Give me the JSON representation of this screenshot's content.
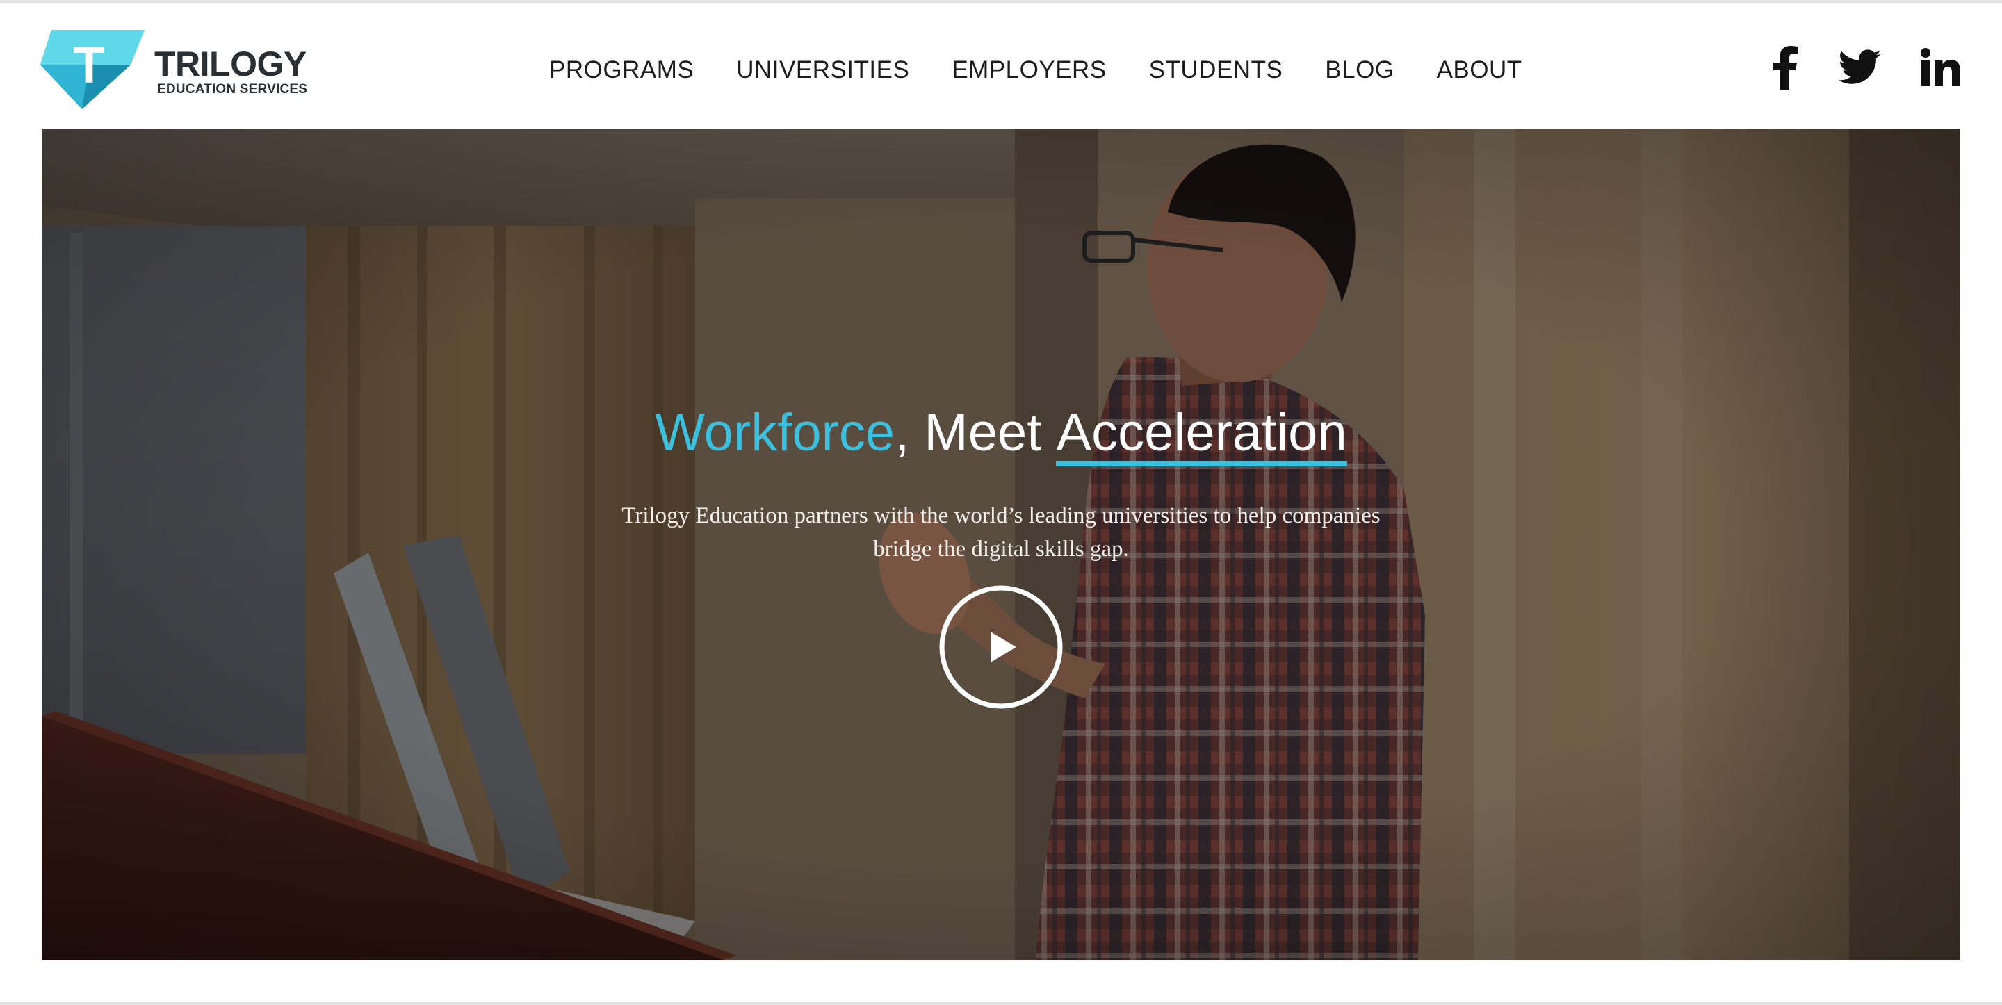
{
  "logo": {
    "wordmark": "TRILOGY",
    "subtitle": "EDUCATION SERVICES",
    "mark_letter": "T",
    "colors": {
      "light": "#5fd8ea",
      "mid": "#2fb5d3",
      "dark": "#1a8fae"
    }
  },
  "nav": {
    "items": [
      "PROGRAMS",
      "UNIVERSITIES",
      "EMPLOYERS",
      "STUDENTS",
      "BLOG",
      "ABOUT"
    ]
  },
  "social": {
    "icons": [
      "facebook-icon",
      "twitter-icon",
      "linkedin-icon"
    ]
  },
  "hero": {
    "title_accent": "Workforce",
    "title_middle": ", Meet ",
    "title_underlined": "Acceleration",
    "description": "Trilogy Education partners with the world’s leading universities to help companies bridge the digital skills gap.",
    "play_icon": "play-icon",
    "accent_color": "#3cc0de"
  }
}
